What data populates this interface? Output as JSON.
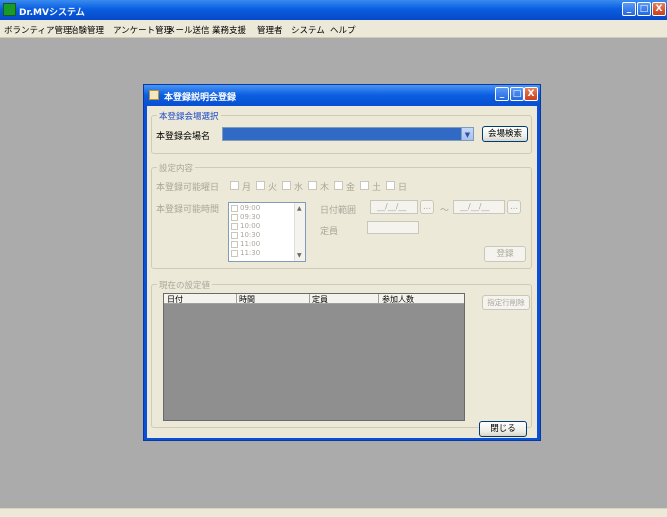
{
  "app": {
    "title": "Dr.MVシステム",
    "window_buttons": {
      "minimize": "_",
      "maximize": "□",
      "close": "X"
    }
  },
  "menu": {
    "items": [
      "ボランティア管理",
      "治験管理",
      "アンケート管理",
      "メール送信",
      "業務支援",
      "管理者",
      "システム",
      "ヘルプ"
    ]
  },
  "dialog": {
    "title": "本登録説明会登録",
    "buttons": {
      "minimize": "_",
      "maximize": "□",
      "close": "X"
    },
    "venue_group": {
      "title": "本登録会場選択",
      "venue_label": "本登録会場名",
      "venue_value": "",
      "search_button": "会場検索"
    },
    "settings_group": {
      "title": "設定内容",
      "weekday_label": "本登録可能曜日",
      "weekdays": [
        "月",
        "火",
        "水",
        "木",
        "金",
        "土",
        "日"
      ],
      "time_label": "本登録可能時間",
      "times": [
        "09:00",
        "09:30",
        "10:00",
        "10:30",
        "11:00",
        "11:30"
      ],
      "date_range_label": "日付範囲",
      "date_from": "__/__/__",
      "date_to": "__/__/__",
      "date_button": "...",
      "range_separator": "～",
      "capacity_label": "定員",
      "capacity_value": "",
      "register_button": "登録"
    },
    "current_group": {
      "title": "現在の設定値",
      "columns": [
        "日付",
        "時間",
        "定員",
        "参加人数"
      ],
      "rows": [],
      "delete_button": "指定行削除"
    },
    "close_button": "閉じる"
  },
  "colors": {
    "title_bar": "#0a5ee0",
    "workspace": "#ababab",
    "dialog_face": "#ece9d8",
    "selection": "#316ac5",
    "group_title": "#1a46c8"
  }
}
